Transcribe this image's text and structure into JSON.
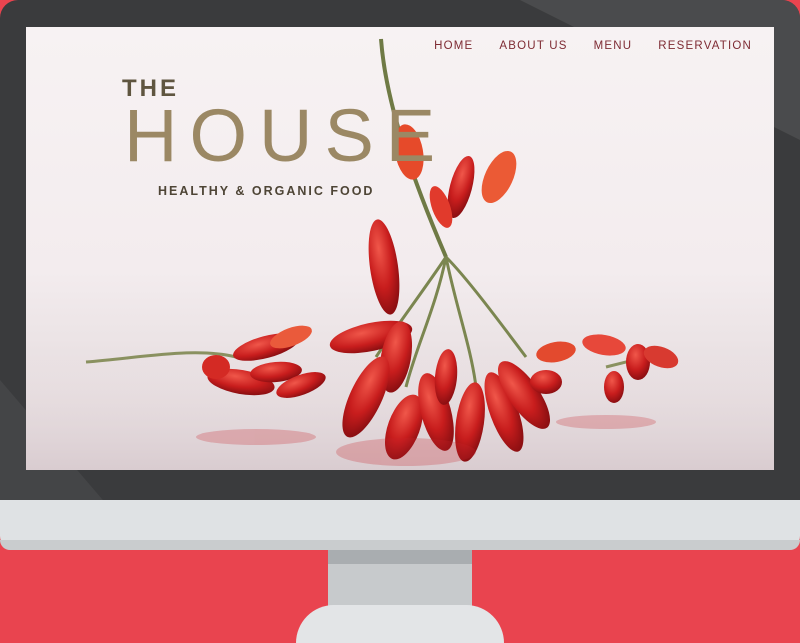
{
  "nav": {
    "items": [
      {
        "label": "HOME"
      },
      {
        "label": "ABOUT US"
      },
      {
        "label": "MENU"
      },
      {
        "label": "RESERVATION"
      }
    ]
  },
  "brand": {
    "the": "THE",
    "house": "HOUSE",
    "tagline": "HEALTHY & ORGANIC FOOD"
  },
  "colors": {
    "background": "#e9444f",
    "bezel": "#3a3b3d",
    "nav_text": "#7e2b33",
    "brand_gold": "#9b8864",
    "pepper_red": "#d0201f"
  }
}
